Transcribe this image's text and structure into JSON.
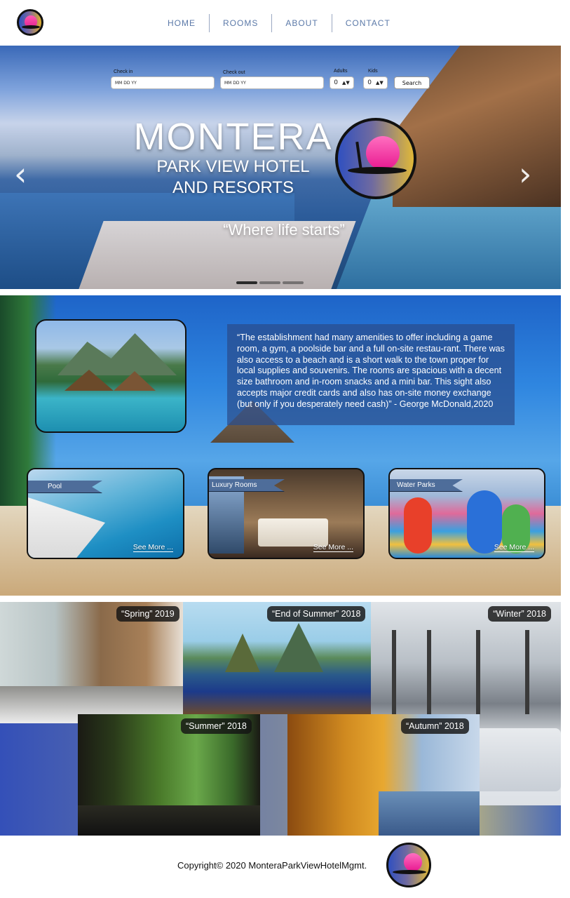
{
  "nav": {
    "items": [
      {
        "label": "HOME"
      },
      {
        "label": "ROOMS"
      },
      {
        "label": "ABOUT"
      },
      {
        "label": "CONTACT"
      }
    ]
  },
  "booking": {
    "checkin_label": "Check in",
    "checkin_placeholder": "MM DD YY",
    "checkout_label": "Check out",
    "checkout_placeholder": "MM DD YY",
    "adults_label": "Adults",
    "adults_value": "0",
    "kids_label": "Kids",
    "kids_value": "0",
    "search_label": "Search"
  },
  "hero": {
    "title": "MONTERA",
    "subtitle_line1": "PARK VIEW HOTEL",
    "subtitle_line2": "AND RESORTS",
    "tagline": "“Where life starts”",
    "prev_arrow": "‹",
    "next_arrow": "›",
    "slide_count": 3,
    "active_slide": 1
  },
  "testimonial": {
    "text": "“The establishment had many amenities to offer including a game room, a gym, a poolside bar and a full on-site restau-rant. There was also access to a beach and is a short walk to the town proper for local supplies and souvenirs. The rooms are spacious with a decent size bathroom and in-room snacks and a mini bar. This sight also accepts major credit cards and also has on-site money exchange (but only if you desperately need cash)”       - George McDonald,2020"
  },
  "cards": [
    {
      "label": "Pool",
      "link": "See More ..."
    },
    {
      "label": "Luxury Rooms",
      "link": "See More ..."
    },
    {
      "label": "Water Parks",
      "link": "See More ..."
    }
  ],
  "gallery": {
    "spring": "“Spring” 2019",
    "end_of_summer": "“End of Summer” 2018",
    "winter": "“Winter” 2018",
    "summer": "“Summer” 2018",
    "autumn": "“Autumn” 2018"
  },
  "footer": {
    "copyright": "Copyright© 2020 MonteraParkViewHotelMgmt."
  },
  "colors": {
    "nav_text": "#5b79a8",
    "card_label_bg": "#4e6d9a",
    "quote_bg": "#2a4c8c"
  }
}
